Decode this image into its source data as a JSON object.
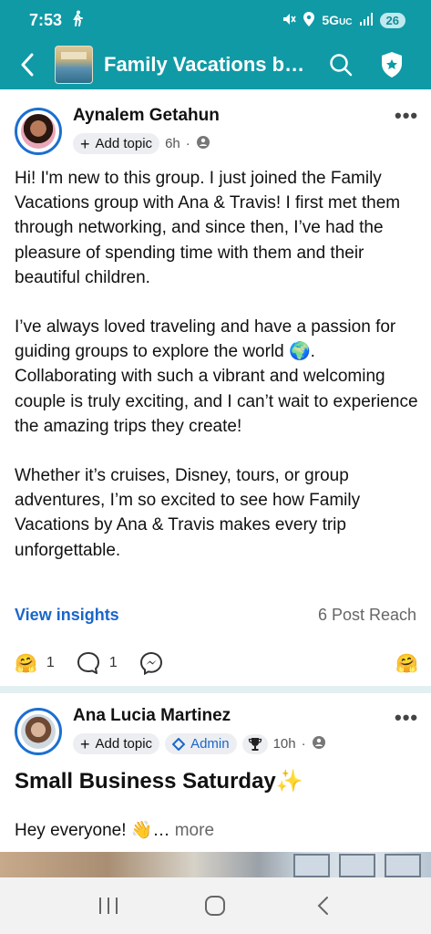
{
  "status_bar": {
    "time": "7:53",
    "network": "5G",
    "network_suffix": "UC",
    "battery": "26"
  },
  "header": {
    "group_name": "Family Vacations by…"
  },
  "post1": {
    "author": "Aynalem Getahun",
    "add_topic": "Add topic",
    "time": "6h",
    "body": [
      "Hi! I'm new to this group. I just joined the Family Vacations group with Ana & Travis! I first met them through networking, and since then, I’ve had the pleasure of spending time with them and their beautiful children.",
      "I’ve always loved traveling and have a passion for guiding groups to explore the world 🌍. Collaborating with such a vibrant and welcoming couple is truly exciting, and I can’t wait to experience the amazing trips they create!",
      "Whether it’s cruises, Disney, tours, or group adventures, I’m so excited to see how Family Vacations by Ana & Travis makes every trip unforgettable."
    ],
    "view_insights": "View insights",
    "post_reach": "6 Post Reach",
    "reaction_count": "1",
    "comment_count": "1"
  },
  "post2": {
    "author": "Ana Lucia Martinez",
    "add_topic": "Add topic",
    "admin_badge": "Admin",
    "time": "10h",
    "title": "Small Business Saturday✨",
    "snippet": "Hey everyone! 👋…",
    "more": "more"
  },
  "colors": {
    "header_teal": "#0f9aa6",
    "link_blue": "#1a66c9",
    "avatar_ring": "#1c6fd0"
  },
  "icons": {
    "back": "chevron-left-icon",
    "search": "search-icon",
    "shield": "shield-star-icon",
    "more": "more-dots-icon",
    "globe": "privacy-members-icon",
    "comment": "comment-bubble-icon",
    "messenger": "messenger-icon",
    "reaction": "hug-face-icon"
  }
}
